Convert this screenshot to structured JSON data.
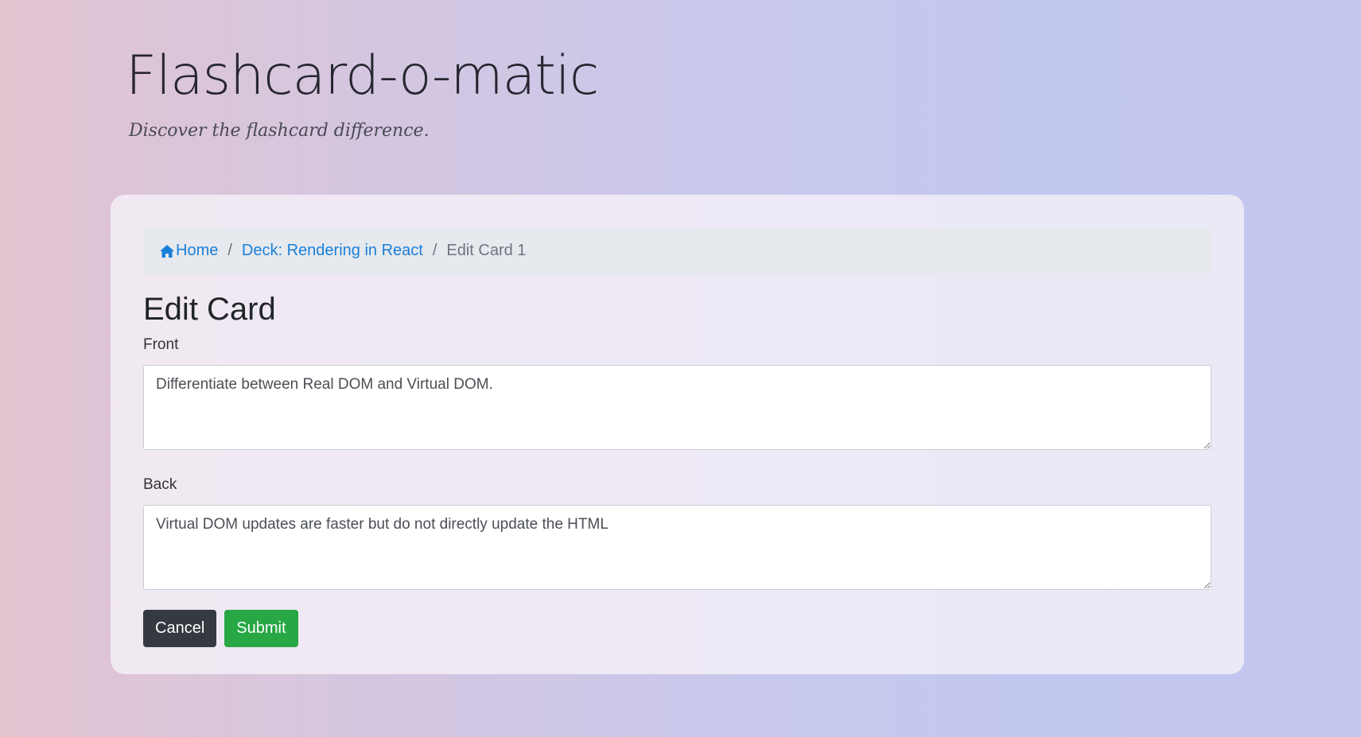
{
  "header": {
    "title": "Flashcard-o-matic",
    "tagline": "Discover the flashcard difference."
  },
  "breadcrumb": {
    "home_label": "Home",
    "deck_label": "Deck: Rendering in React",
    "current_label": "Edit Card 1",
    "separator": "/",
    "home_icon": "home-icon"
  },
  "form": {
    "title": "Edit Card",
    "front_label": "Front",
    "front_value": "Differentiate between Real DOM and Virtual DOM.",
    "back_label": "Back",
    "back_value": "Virtual DOM updates are faster but do not directly update the HTML",
    "cancel_label": "Cancel",
    "submit_label": "Submit"
  },
  "colors": {
    "link": "#1a7fd8",
    "cancel_button": "#343a40",
    "submit_button": "#28a745",
    "breadcrumb_bg": "#e6e9ee"
  }
}
